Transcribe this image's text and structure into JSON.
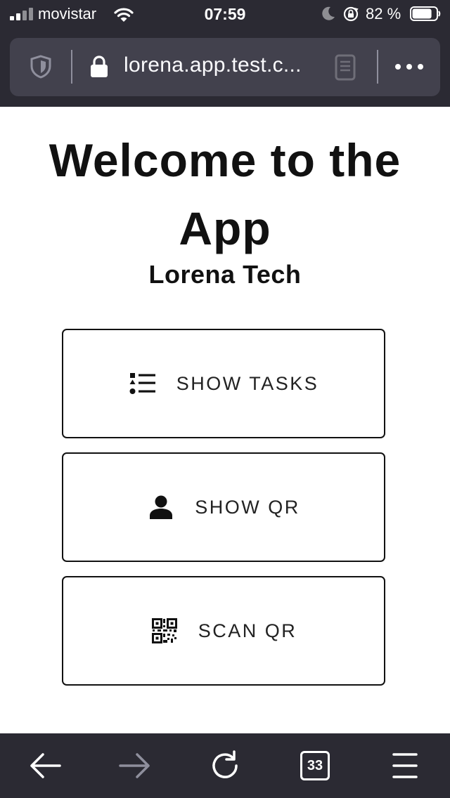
{
  "status_bar": {
    "carrier": "movistar",
    "time": "07:59",
    "battery_percent": "82 %",
    "battery_level": 0.82
  },
  "browser": {
    "url": "lorena.app.test.c...",
    "tab_count": "33"
  },
  "page": {
    "title": "Welcome to the App",
    "subtitle": "Lorena Tech",
    "buttons": [
      {
        "label": "SHOW TASKS",
        "icon": "task-list-icon"
      },
      {
        "label": "SHOW QR",
        "icon": "person-icon"
      },
      {
        "label": "SCAN QR",
        "icon": "qr-code-icon"
      }
    ]
  },
  "colors": {
    "chrome_background": "#2b2a33",
    "url_bar_background": "#42414d",
    "page_background": "#ffffff",
    "text": "#111111"
  }
}
